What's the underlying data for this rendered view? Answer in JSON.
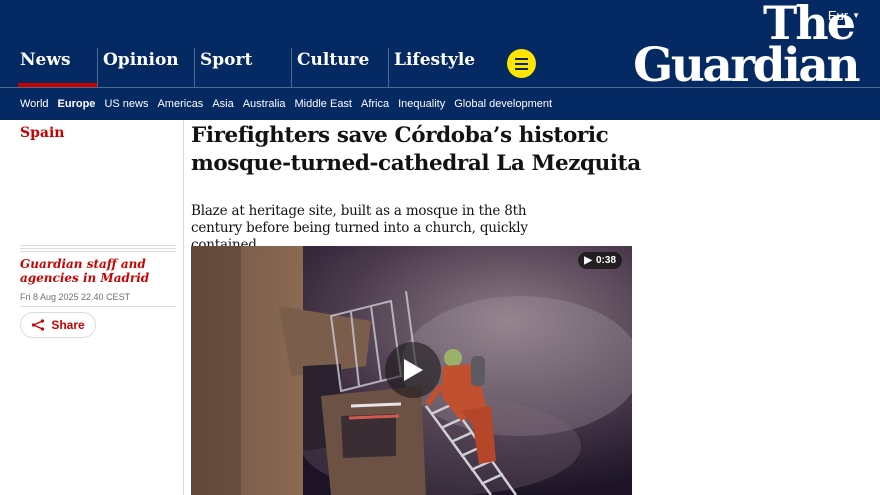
{
  "header": {
    "edition": "Eur",
    "logo_line1": "The",
    "logo_line2": "Guardian",
    "pillars": [
      "News",
      "Opinion",
      "Sport",
      "Culture",
      "Lifestyle"
    ],
    "subnav": [
      "World",
      "Europe",
      "US news",
      "Americas",
      "Asia",
      "Australia",
      "Middle East",
      "Africa",
      "Inequality",
      "Global development"
    ]
  },
  "article": {
    "section": "Spain",
    "headline": "Firefighters save Córdoba’s historic mosque-turned-cathedral La Mezquita",
    "standfirst": "Blaze at heritage site, built as a mosque in the 8th century before being turned into a church, quickly contained",
    "byline": "Guardian staff and agencies in Madrid",
    "dateline": "Fri 8 Aug 2025 22.40 CEST",
    "share_label": "Share",
    "video_duration": "0:38"
  },
  "colors": {
    "brand": "#052962",
    "news_red": "#c70000",
    "menu_yellow": "#ffe500"
  },
  "icons": [
    "chevron-down-icon",
    "menu-icon",
    "share-icon",
    "play-icon"
  ]
}
